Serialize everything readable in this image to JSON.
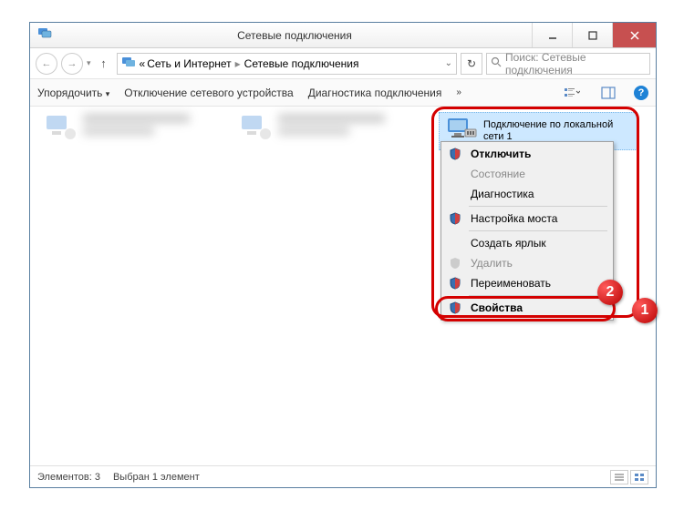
{
  "titlebar": {
    "title": "Сетевые подключения"
  },
  "breadcrumb": {
    "prefix": "«",
    "parent": "Сеть и Интернет",
    "current": "Сетевые подключения"
  },
  "search": {
    "placeholder": "Поиск: Сетевые подключения"
  },
  "cmdbar": {
    "organize": "Упорядочить",
    "disable": "Отключение сетевого устройства",
    "diagnostics": "Диагностика подключения",
    "more": "»"
  },
  "selected_connection": {
    "name": "Подключение по локальной сети 1"
  },
  "context_menu": {
    "disable": "Отключить",
    "status": "Состояние",
    "diagnostics": "Диагностика",
    "bridge": "Настройка моста",
    "shortcut": "Создать ярлык",
    "delete": "Удалить",
    "rename": "Переименовать",
    "properties": "Свойства"
  },
  "callouts": {
    "one": "1",
    "two": "2"
  },
  "statusbar": {
    "elements": "Элементов: 3",
    "selected": "Выбран 1 элемент"
  }
}
